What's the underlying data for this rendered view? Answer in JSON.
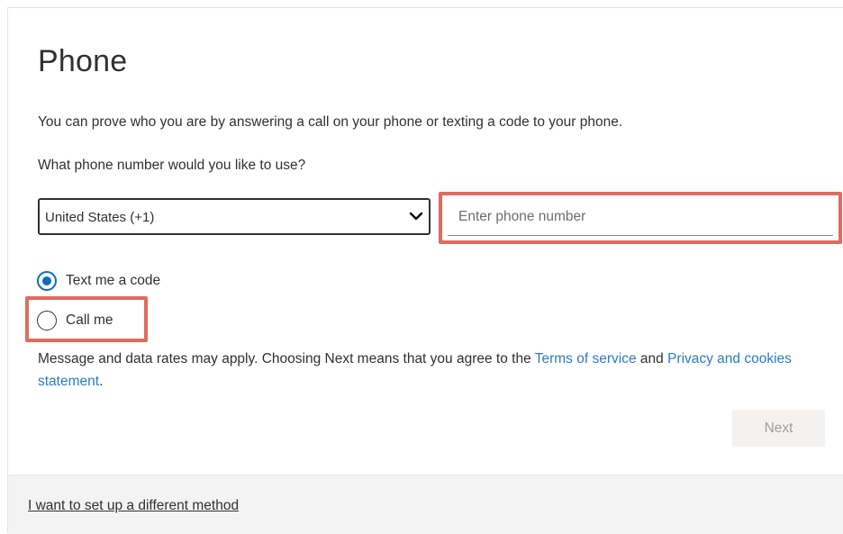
{
  "page": {
    "title": "Phone",
    "intro": "You can prove who you are by answering a call on your phone or texting a code to your phone.",
    "question": "What phone number would you like to use?"
  },
  "country_select": {
    "value": "United States (+1)"
  },
  "phone_input": {
    "placeholder": "Enter phone number",
    "value": ""
  },
  "method_options": [
    {
      "label": "Text me a code",
      "selected": true
    },
    {
      "label": "Call me",
      "selected": false
    }
  ],
  "disclaimer": {
    "text_before": "Message and data rates may apply. Choosing Next means that you agree to the ",
    "terms_link": "Terms of service",
    "and": " and ",
    "privacy_link": "Privacy and cookies statement",
    "end": "."
  },
  "next_button": {
    "label": "Next",
    "disabled": true
  },
  "footer": {
    "different_method_link": "I want to set up a different method"
  },
  "colors": {
    "accent": "#0f6cbd",
    "link": "#2c7bc6",
    "highlight": "#e06b5f",
    "footer_bg": "#f3f3f3"
  },
  "icons": {
    "select_chevron": "chevron-down-icon"
  }
}
